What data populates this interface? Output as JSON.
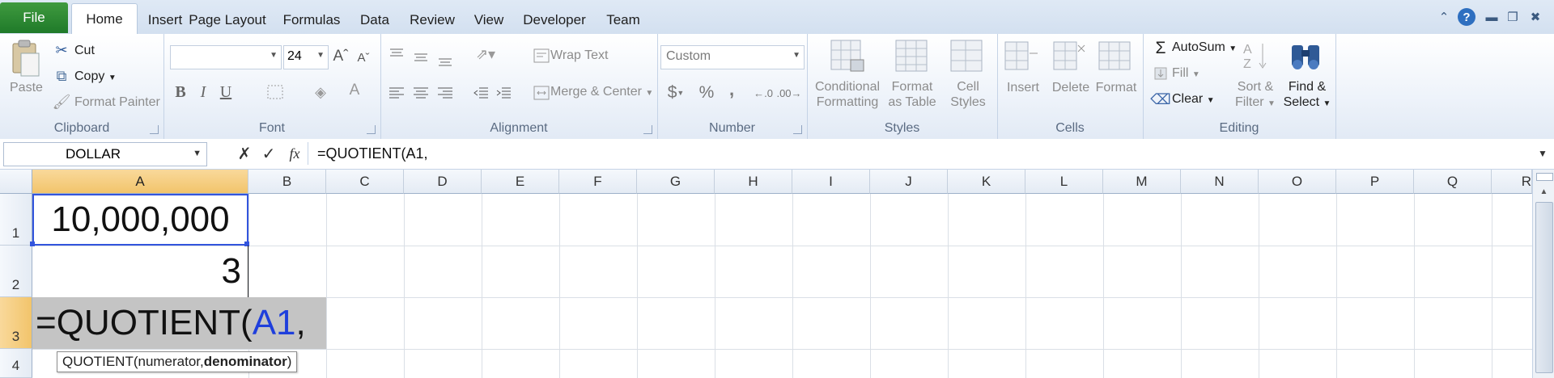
{
  "tabs": {
    "file": "File",
    "items": [
      "Home",
      "Insert",
      "Page Layout",
      "Formulas",
      "Data",
      "Review",
      "View",
      "Developer",
      "Team"
    ]
  },
  "ribbon": {
    "clipboard": {
      "label": "Clipboard",
      "paste": "Paste",
      "cut": "Cut",
      "copy": "Copy",
      "format_painter": "Format Painter"
    },
    "font": {
      "label": "Font",
      "size": "24",
      "bold": "B",
      "italic": "I",
      "underline": "U"
    },
    "alignment": {
      "label": "Alignment",
      "wrap_text": "Wrap Text",
      "merge_center": "Merge & Center"
    },
    "number": {
      "label": "Number",
      "format": "Custom",
      "currency": "$",
      "percent": "%",
      "comma": ","
    },
    "styles": {
      "label": "Styles",
      "conditional_1": "Conditional",
      "conditional_2": "Formatting",
      "format_table_1": "Format",
      "format_table_2": "as Table",
      "cell_styles_1": "Cell",
      "cell_styles_2": "Styles"
    },
    "cells": {
      "label": "Cells",
      "insert": "Insert",
      "delete": "Delete",
      "format": "Format"
    },
    "editing": {
      "label": "Editing",
      "autosum": "AutoSum",
      "fill": "Fill",
      "clear": "Clear",
      "sort_1": "Sort &",
      "sort_2": "Filter",
      "find_1": "Find &",
      "find_2": "Select"
    }
  },
  "formula_bar": {
    "name_box": "DOLLAR",
    "fx": "fx",
    "formula": "=QUOTIENT(A1,"
  },
  "columns": [
    "A",
    "B",
    "C",
    "D",
    "E",
    "F",
    "G",
    "H",
    "I",
    "J",
    "K",
    "L",
    "M",
    "N",
    "O",
    "P",
    "Q",
    "R"
  ],
  "rows": [
    "1",
    "2",
    "3",
    "4"
  ],
  "cells": {
    "A1": "10,000,000",
    "A2": "3",
    "A3_prefix": "=QUOTIENT(",
    "A3_ref": "A1",
    "A3_suffix": ","
  },
  "tooltip": {
    "func": "QUOTIENT(numerator, ",
    "arg": "denominator",
    ")": ")"
  },
  "colors": {
    "accent": "#1e7145",
    "ref_blue": "#1f3fdc",
    "selected_header": "#f2c46b"
  }
}
